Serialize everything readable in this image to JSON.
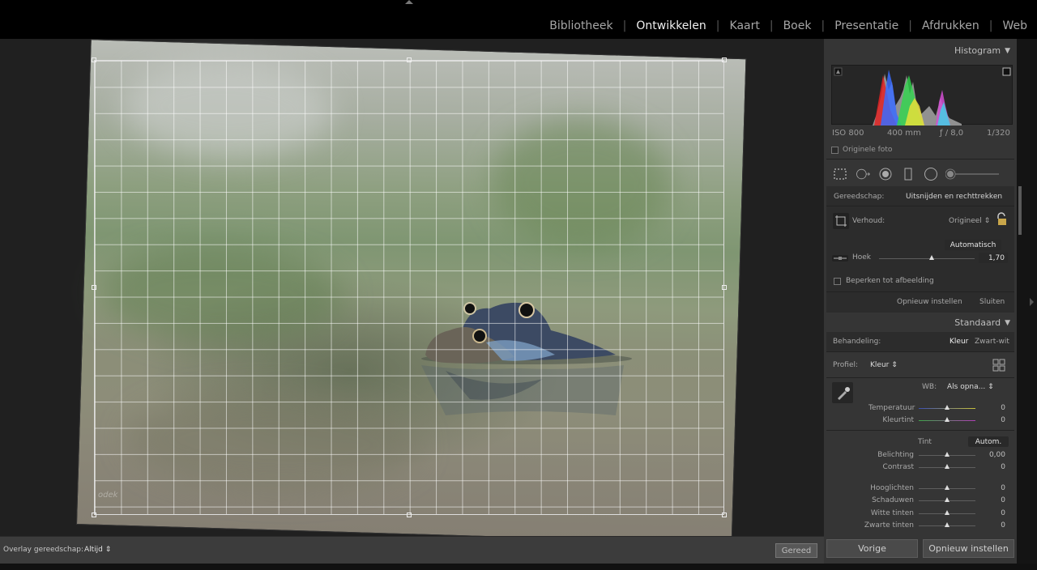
{
  "modules": [
    {
      "label": "Bibliotheek",
      "active": false
    },
    {
      "label": "Ontwikkelen",
      "active": true
    },
    {
      "label": "Kaart",
      "active": false
    },
    {
      "label": "Boek",
      "active": false
    },
    {
      "label": "Presentatie",
      "active": false
    },
    {
      "label": "Afdrukken",
      "active": false
    },
    {
      "label": "Web",
      "active": false
    }
  ],
  "photo": {
    "watermark": "odek"
  },
  "toolbar": {
    "overlay_label": "Overlay gereedschap:",
    "overlay_value": "Altijd",
    "done_label": "Gereed"
  },
  "histogram": {
    "title": "Histogram",
    "iso": "ISO 800",
    "focal": "400 mm",
    "aperture": "ƒ / 8,0",
    "shutter": "1/320",
    "original_photo": "Originele foto"
  },
  "crop": {
    "tool_label": "Gereedschap:",
    "tool_name": "Uitsnijden en rechttrekken",
    "aspect_label": "Verhoud:",
    "aspect_value": "Origineel",
    "auto_label": "Automatisch",
    "angle_label": "Hoek",
    "angle_value": "1,70",
    "angle_level": 0.55,
    "constrain_label": "Beperken tot afbeelding",
    "reset_label": "Opnieuw instellen",
    "close_label": "Sluiten"
  },
  "basic": {
    "title": "Standaard",
    "treatment_label": "Behandeling:",
    "color_label": "Kleur",
    "bw_label": "Zwart-wit",
    "profile_label": "Profiel:",
    "profile_value": "Kleur",
    "wb_label": "WB:",
    "wb_value": "Als opna...",
    "temp_label": "Temperatuur",
    "temp_value": "0",
    "tint_label": "Kleurtint",
    "tint_value": "0",
    "tone_label": "Tint",
    "tone_auto": "Autom.",
    "exposure_label": "Belichting",
    "exposure_value": "0,00",
    "contrast_label": "Contrast",
    "contrast_value": "0",
    "highlights_label": "Hooglichten",
    "highlights_value": "0",
    "shadows_label": "Schaduwen",
    "shadows_value": "0",
    "whites_label": "Witte tinten",
    "whites_value": "0",
    "blacks_label": "Zwarte tinten",
    "blacks_value": "0"
  },
  "footer": {
    "prev_label": "Vorige",
    "reset_label": "Opnieuw instellen"
  }
}
